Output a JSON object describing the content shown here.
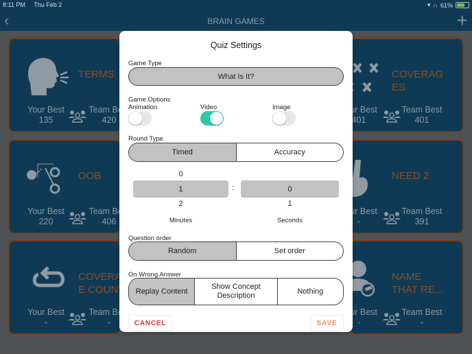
{
  "status_bar": {
    "time": "8:11 PM",
    "date": "Thu Feb 2",
    "battery": "61%"
  },
  "nav": {
    "title": "BRAIN GAMES",
    "back_icon": "chevron-left",
    "add_icon": "plus"
  },
  "cards": [
    {
      "title": "TERMS",
      "icon": "speaking-head",
      "your_best_label": "Your Best",
      "your_best": "135",
      "team_best_label": "Team Best",
      "team_best": "420"
    },
    {
      "title": "COVERAGES",
      "icon": "x-formation",
      "your_best_label": "Your Best",
      "your_best": "401",
      "team_best_label": "Team Best",
      "team_best": "401"
    },
    {
      "title": "OOB",
      "icon": "play-diagram",
      "your_best_label": "Your Best",
      "your_best": "220",
      "team_best_label": "Team Best",
      "team_best": "406"
    },
    {
      "title": "NEED 2",
      "icon": "two-fingers-hand",
      "your_best_label": "Your Best",
      "your_best": "-",
      "team_best_label": "Team Best",
      "team_best": "391"
    },
    {
      "title": "COVERAGE COUNT",
      "icon": "replay-arrow",
      "your_best_label": "Your Best",
      "your_best": "-",
      "team_best_label": "Team Best",
      "team_best": "-"
    },
    {
      "title": "NAME THAT RE...",
      "icon": "person-whistle",
      "your_best_label": "Your Best",
      "your_best": "-",
      "team_best_label": "Team Best",
      "team_best": "-"
    }
  ],
  "modal": {
    "title": "Quiz Settings",
    "game_type_label": "Game Type",
    "game_type_value": "What Is It?",
    "game_options_label": "Game Options",
    "toggles": [
      {
        "label": "Animation",
        "on": false
      },
      {
        "label": "Video",
        "on": true
      },
      {
        "label": "Image",
        "on": false
      }
    ],
    "round_type_label": "Round Type",
    "round_type_options": [
      "Timed",
      "Accuracy"
    ],
    "round_type_selected": "Timed",
    "minutes": {
      "prev": "0",
      "value": "1",
      "next": "2",
      "label": "Minutes"
    },
    "seconds": {
      "prev": "",
      "value": "0",
      "next": "1",
      "label": "Seconds"
    },
    "separator": ":",
    "question_order_label": "Question order",
    "question_order_options": [
      "Random",
      "Set order"
    ],
    "question_order_selected": "Random",
    "wrong_answer_label": "On Wrong Answer",
    "wrong_answer_options": [
      "Replay Content",
      "Show Concept Description",
      "Nothing"
    ],
    "wrong_answer_selected": "Replay Content",
    "cancel_label": "CANCEL",
    "save_label": "SAVE"
  },
  "colors": {
    "nav_bg": "#0f3a55",
    "card_border": "#7a3d17",
    "card_title": "#8a4d22",
    "toggle_on": "#2fc8aa",
    "cancel": "#d7333a",
    "save": "#ec8b55",
    "segment_selected": "#c2c2c2"
  }
}
